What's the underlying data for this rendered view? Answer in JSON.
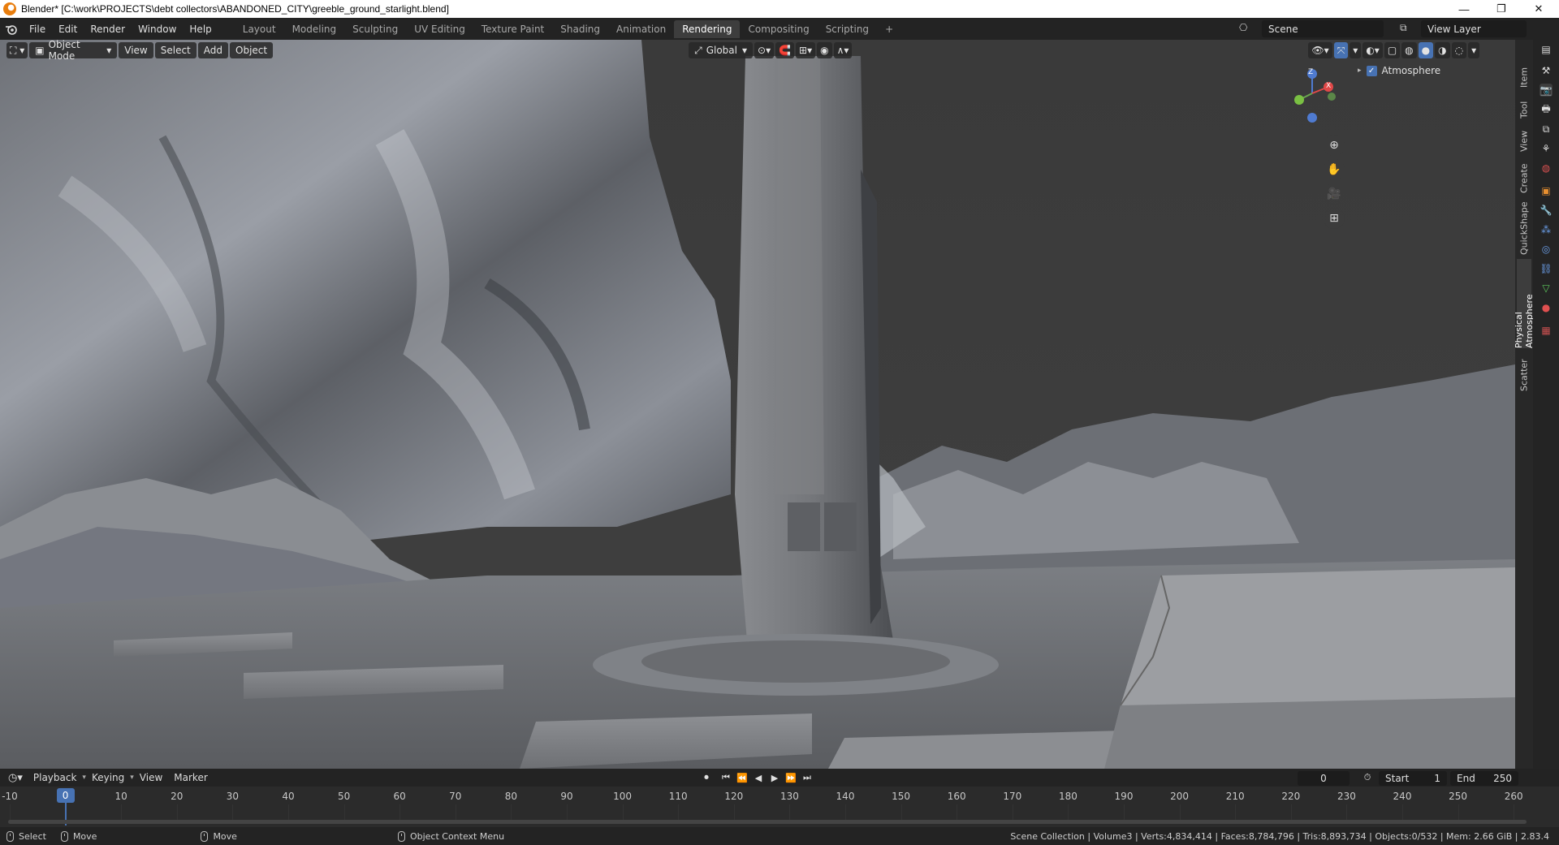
{
  "window": {
    "title": "Blender* [C:\\work\\PROJECTS\\debt collectors\\ABANDONED_CITY\\greeble_ground_starlight.blend]",
    "controls": [
      "—",
      "❐",
      "✕"
    ]
  },
  "menubar": {
    "items": [
      "File",
      "Edit",
      "Render",
      "Window",
      "Help"
    ]
  },
  "workspaces": {
    "tabs": [
      "Layout",
      "Modeling",
      "Sculpting",
      "UV Editing",
      "Texture Paint",
      "Shading",
      "Animation",
      "Rendering",
      "Compositing",
      "Scripting"
    ],
    "active": "Rendering",
    "add_label": "+"
  },
  "scene": {
    "label": "Scene"
  },
  "view_layer": {
    "label": "View Layer"
  },
  "viewport_header": {
    "mode": "Object Mode",
    "menus": [
      "View",
      "Select",
      "Add",
      "Object"
    ],
    "transform_orientation": "Global"
  },
  "gizmo": {
    "x_label": "X",
    "z_label": "Z"
  },
  "outliner": {
    "item_label": "Atmosphere",
    "checked": true
  },
  "sidebar_tabs": [
    "Item",
    "Tool",
    "View",
    "Create",
    "QuickShape",
    "Physical Atmosphere",
    "Scatter"
  ],
  "sidebar_active": "Physical Atmosphere",
  "timeline_header": {
    "menus": [
      "Playback",
      "Keying",
      "View",
      "Marker"
    ],
    "current_frame": "0",
    "start_label": "Start",
    "start_value": "1",
    "end_label": "End",
    "end_value": "250"
  },
  "timeline": {
    "ticks": [
      "-10",
      "0",
      "10",
      "20",
      "30",
      "40",
      "50",
      "60",
      "70",
      "80",
      "90",
      "100",
      "110",
      "120",
      "130",
      "140",
      "150",
      "160",
      "170",
      "180",
      "190",
      "200",
      "210",
      "220",
      "230",
      "240",
      "250",
      "260"
    ],
    "playhead": "0"
  },
  "statusbar": {
    "left": [
      "Select",
      "Move",
      "Move",
      "Object Context Menu"
    ],
    "stats": "Scene Collection | Volume3 | Verts:4,834,414 | Faces:8,784,796 | Tris:8,893,734 | Objects:0/532 | Mem: 2.66 GiB | 2.83.4"
  },
  "colors": {
    "accent": "#4772b3",
    "bg": "#303030",
    "header": "#232323"
  }
}
